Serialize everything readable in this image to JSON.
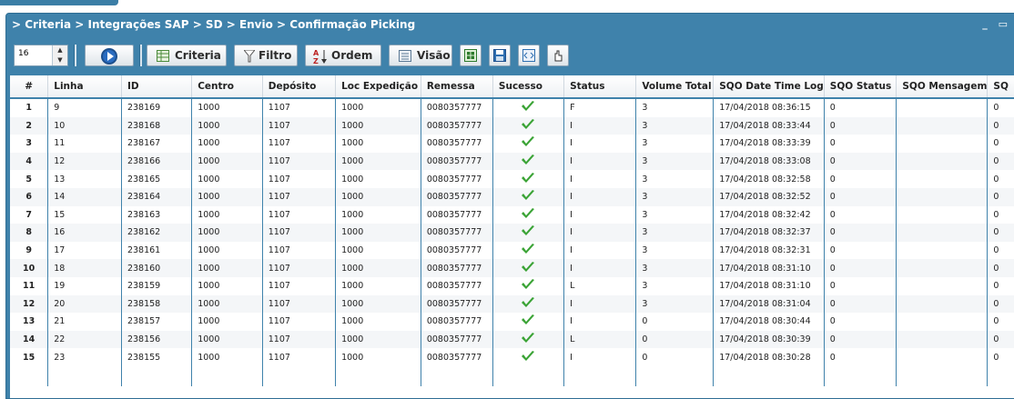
{
  "breadcrumb": "> Criteria > Integrações SAP > SD > Envio > Confirmação Picking",
  "window_controls": "_ ▭",
  "toolbar": {
    "page_size": "16",
    "criteria_label": "Criteria",
    "filtro_label": "Filtro",
    "ordem_label": "Ordem",
    "visao_label": "Visão"
  },
  "columns": [
    "#",
    "Linha",
    "ID",
    "Centro",
    "Depósito",
    "Loc Expedição",
    "Remessa",
    "Sucesso",
    "Status",
    "Volume Total",
    "SQO Date Time Log",
    "SQO Status",
    "SQO Mensagem",
    "SQ"
  ],
  "rows": [
    {
      "n": "1",
      "linha": "9",
      "id": "238169",
      "centro": "1000",
      "deposito": "1107",
      "loc": "1000",
      "remessa": "0080357777",
      "status": "F",
      "volume": "3",
      "dt": "17/04/2018 08:36:15",
      "sqo_status": "0",
      "sqo_msg": "",
      "sq": "0"
    },
    {
      "n": "2",
      "linha": "10",
      "id": "238168",
      "centro": "1000",
      "deposito": "1107",
      "loc": "1000",
      "remessa": "0080357777",
      "status": "I",
      "volume": "3",
      "dt": "17/04/2018 08:33:44",
      "sqo_status": "0",
      "sqo_msg": "",
      "sq": "0"
    },
    {
      "n": "3",
      "linha": "11",
      "id": "238167",
      "centro": "1000",
      "deposito": "1107",
      "loc": "1000",
      "remessa": "0080357777",
      "status": "I",
      "volume": "3",
      "dt": "17/04/2018 08:33:39",
      "sqo_status": "0",
      "sqo_msg": "",
      "sq": "0"
    },
    {
      "n": "4",
      "linha": "12",
      "id": "238166",
      "centro": "1000",
      "deposito": "1107",
      "loc": "1000",
      "remessa": "0080357777",
      "status": "I",
      "volume": "3",
      "dt": "17/04/2018 08:33:08",
      "sqo_status": "0",
      "sqo_msg": "",
      "sq": "0"
    },
    {
      "n": "5",
      "linha": "13",
      "id": "238165",
      "centro": "1000",
      "deposito": "1107",
      "loc": "1000",
      "remessa": "0080357777",
      "status": "I",
      "volume": "3",
      "dt": "17/04/2018 08:32:58",
      "sqo_status": "0",
      "sqo_msg": "",
      "sq": "0"
    },
    {
      "n": "6",
      "linha": "14",
      "id": "238164",
      "centro": "1000",
      "deposito": "1107",
      "loc": "1000",
      "remessa": "0080357777",
      "status": "I",
      "volume": "3",
      "dt": "17/04/2018 08:32:52",
      "sqo_status": "0",
      "sqo_msg": "",
      "sq": "0"
    },
    {
      "n": "7",
      "linha": "15",
      "id": "238163",
      "centro": "1000",
      "deposito": "1107",
      "loc": "1000",
      "remessa": "0080357777",
      "status": "I",
      "volume": "3",
      "dt": "17/04/2018 08:32:42",
      "sqo_status": "0",
      "sqo_msg": "",
      "sq": "0"
    },
    {
      "n": "8",
      "linha": "16",
      "id": "238162",
      "centro": "1000",
      "deposito": "1107",
      "loc": "1000",
      "remessa": "0080357777",
      "status": "I",
      "volume": "3",
      "dt": "17/04/2018 08:32:37",
      "sqo_status": "0",
      "sqo_msg": "",
      "sq": "0"
    },
    {
      "n": "9",
      "linha": "17",
      "id": "238161",
      "centro": "1000",
      "deposito": "1107",
      "loc": "1000",
      "remessa": "0080357777",
      "status": "I",
      "volume": "3",
      "dt": "17/04/2018 08:32:31",
      "sqo_status": "0",
      "sqo_msg": "",
      "sq": "0"
    },
    {
      "n": "10",
      "linha": "18",
      "id": "238160",
      "centro": "1000",
      "deposito": "1107",
      "loc": "1000",
      "remessa": "0080357777",
      "status": "I",
      "volume": "3",
      "dt": "17/04/2018 08:31:10",
      "sqo_status": "0",
      "sqo_msg": "",
      "sq": "0"
    },
    {
      "n": "11",
      "linha": "19",
      "id": "238159",
      "centro": "1000",
      "deposito": "1107",
      "loc": "1000",
      "remessa": "0080357777",
      "status": "L",
      "volume": "3",
      "dt": "17/04/2018 08:31:10",
      "sqo_status": "0",
      "sqo_msg": "",
      "sq": "0"
    },
    {
      "n": "12",
      "linha": "20",
      "id": "238158",
      "centro": "1000",
      "deposito": "1107",
      "loc": "1000",
      "remessa": "0080357777",
      "status": "I",
      "volume": "3",
      "dt": "17/04/2018 08:31:04",
      "sqo_status": "0",
      "sqo_msg": "",
      "sq": "0"
    },
    {
      "n": "13",
      "linha": "21",
      "id": "238157",
      "centro": "1000",
      "deposito": "1107",
      "loc": "1000",
      "remessa": "0080357777",
      "status": "I",
      "volume": "0",
      "dt": "17/04/2018 08:30:44",
      "sqo_status": "0",
      "sqo_msg": "",
      "sq": "0"
    },
    {
      "n": "14",
      "linha": "22",
      "id": "238156",
      "centro": "1000",
      "deposito": "1107",
      "loc": "1000",
      "remessa": "0080357777",
      "status": "L",
      "volume": "0",
      "dt": "17/04/2018 08:30:39",
      "sqo_status": "0",
      "sqo_msg": "",
      "sq": "0"
    },
    {
      "n": "15",
      "linha": "23",
      "id": "238155",
      "centro": "1000",
      "deposito": "1107",
      "loc": "1000",
      "remessa": "0080357777",
      "status": "I",
      "volume": "0",
      "dt": "17/04/2018 08:30:28",
      "sqo_status": "0",
      "sqo_msg": "",
      "sq": "0"
    }
  ],
  "icons": {
    "run": "play-icon",
    "criteria": "grid-table-icon",
    "filtro": "funnel-icon",
    "ordem": "sort-az-icon",
    "visao": "view-list-icon",
    "export": "export-excel-icon",
    "save": "save-disk-icon",
    "code": "code-icon",
    "hand": "hand-pointer-icon",
    "sucesso": "checkmark-icon"
  },
  "colors": {
    "window_blue": "#3f82ab",
    "header_text": "#ffffff",
    "check_green": "#3aa335"
  }
}
